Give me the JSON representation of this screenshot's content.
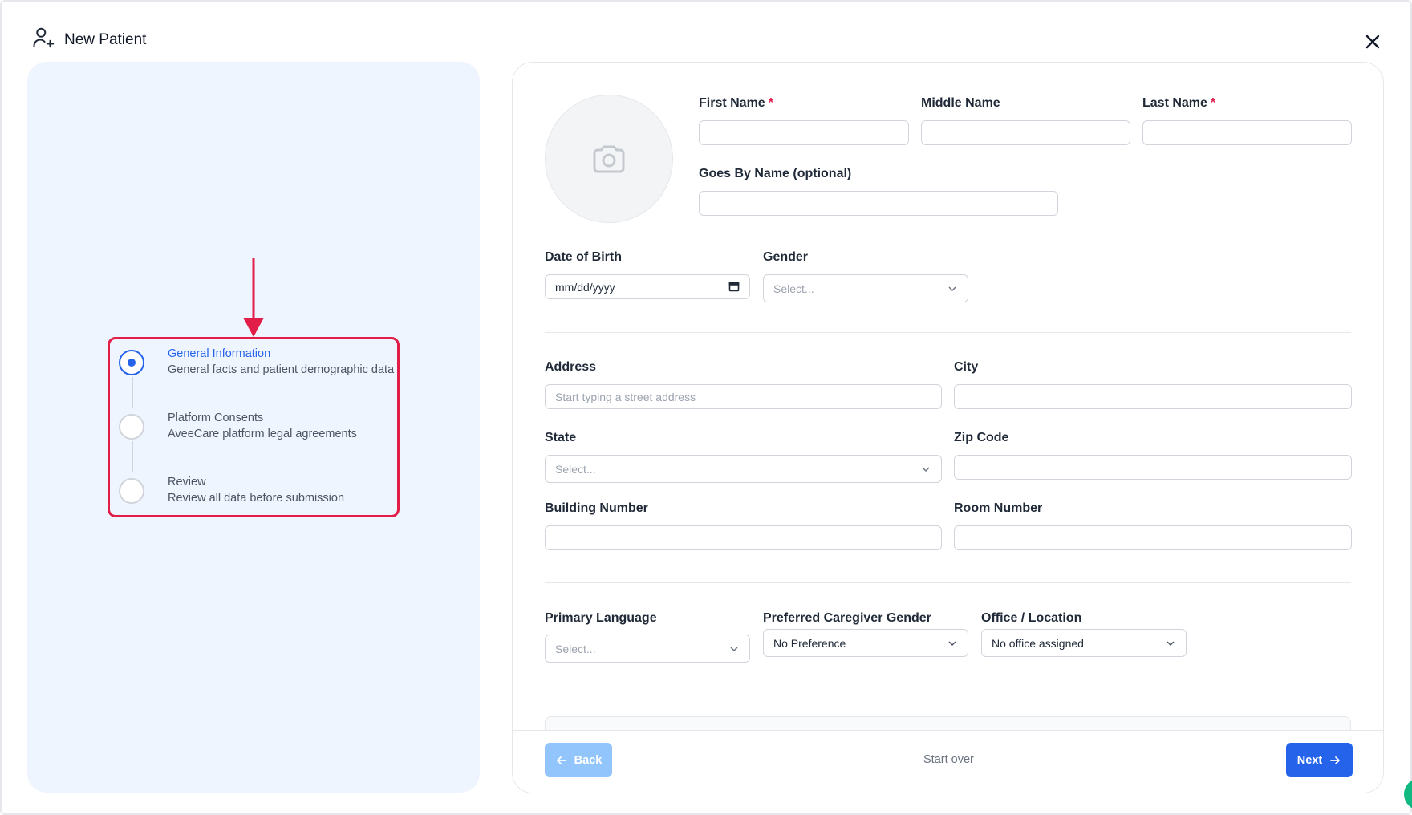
{
  "header": {
    "title": "New Patient",
    "icon": "user-plus-icon"
  },
  "colors": {
    "accent": "#2563eb",
    "highlight": "#e11d48",
    "panel": "#eff5fe"
  },
  "steps": [
    {
      "label": "General Information",
      "desc": "General facts and patient demographic data",
      "active": true
    },
    {
      "label": "Platform Consents",
      "desc": "AveeCare platform legal agreements",
      "active": false
    },
    {
      "label": "Review",
      "desc": "Review all data before submission",
      "active": false
    }
  ],
  "form": {
    "first_name": {
      "label": "First Name",
      "required": "*",
      "value": ""
    },
    "middle_name": {
      "label": "Middle Name",
      "value": ""
    },
    "last_name": {
      "label": "Last Name",
      "required": "*",
      "value": ""
    },
    "goes_by": {
      "label": "Goes By Name (optional)",
      "value": ""
    },
    "dob": {
      "label": "Date of Birth",
      "placeholder": "mm/dd/yyyy"
    },
    "gender": {
      "label": "Gender",
      "placeholder": "Select..."
    },
    "address": {
      "label": "Address",
      "placeholder": "Start typing a street address"
    },
    "city": {
      "label": "City",
      "value": ""
    },
    "state": {
      "label": "State",
      "placeholder": "Select..."
    },
    "zip": {
      "label": "Zip Code",
      "value": ""
    },
    "building": {
      "label": "Building Number",
      "value": ""
    },
    "room": {
      "label": "Room Number",
      "value": ""
    },
    "language": {
      "label": "Primary Language",
      "placeholder": "Select..."
    },
    "caregiver_gender": {
      "label": "Preferred Caregiver Gender",
      "value": "No Preference"
    },
    "office": {
      "label": "Office / Location",
      "value": "No office assigned"
    }
  },
  "footer": {
    "back": "Back",
    "start_over": "Start over",
    "next": "Next"
  }
}
